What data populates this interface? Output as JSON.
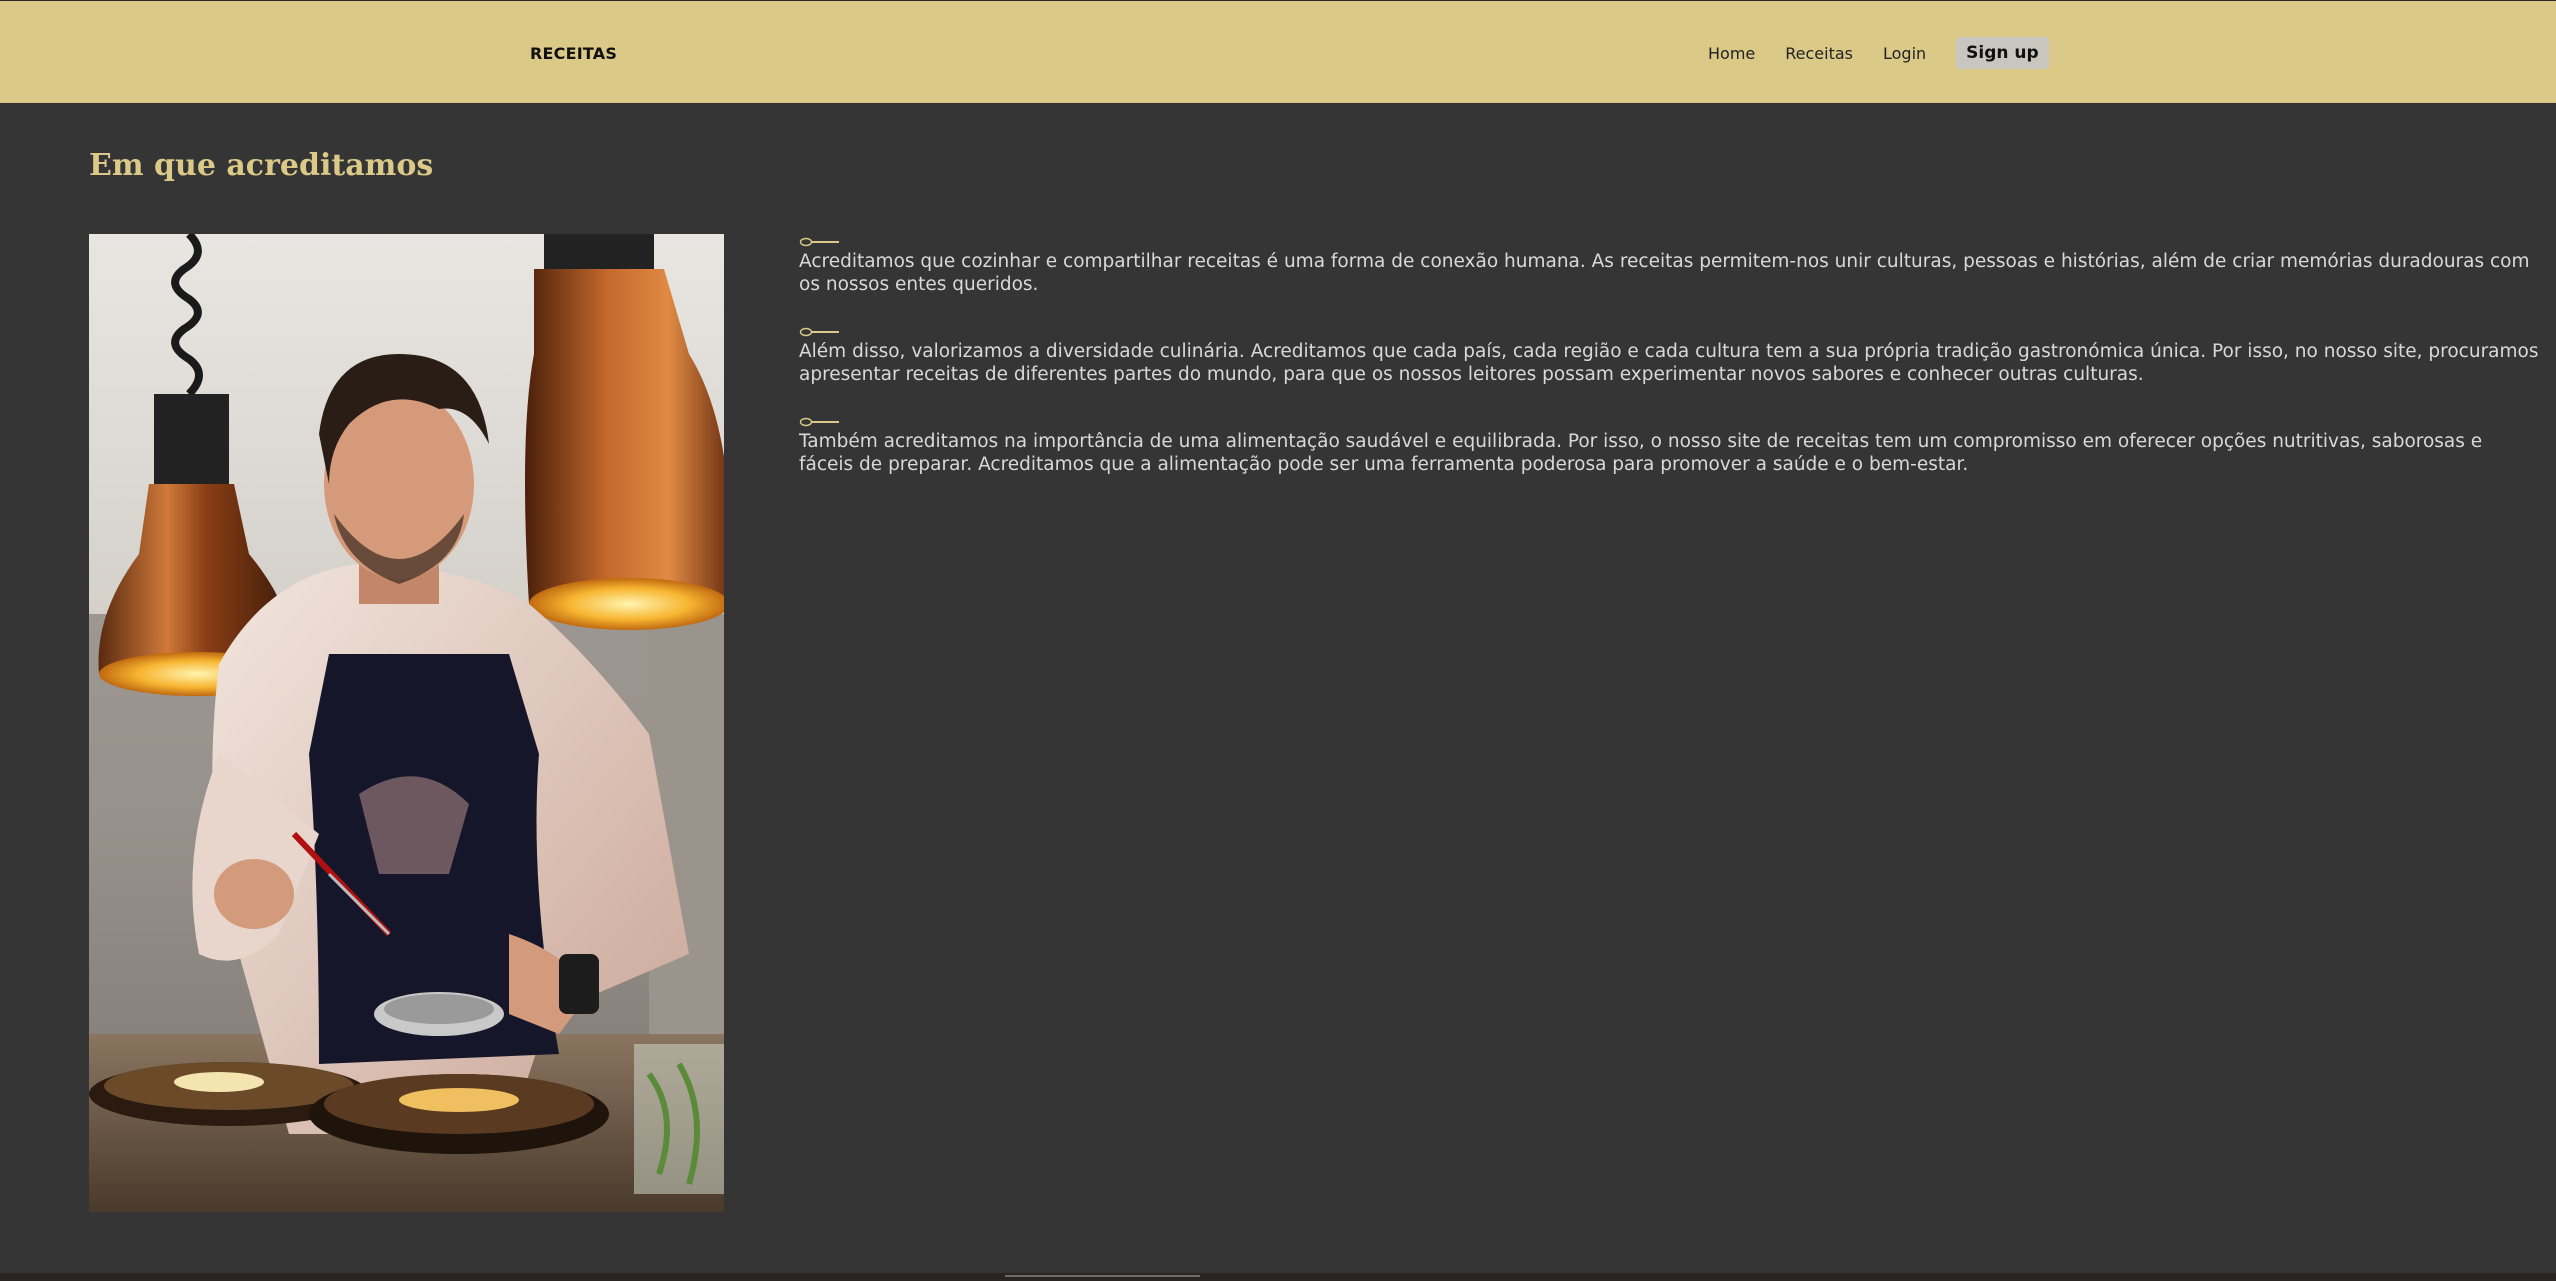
{
  "navbar": {
    "brand": "RECEITAS",
    "links": [
      "Home",
      "Receitas",
      "Login"
    ],
    "signup_label": "Sign up"
  },
  "main": {
    "title": "Em que acreditamos",
    "beliefs": [
      "Acreditamos que cozinhar e compartilhar receitas é uma forma de conexão humana. As receitas permitem-nos unir culturas, pessoas e histórias, além de criar memórias duradouras com os nossos entes queridos.",
      "Além disso, valorizamos a diversidade culinária. Acreditamos que cada país, cada região e cada cultura tem a sua própria tradição gastronómica única. Por isso, no nosso site, procuramos apresentar receitas de diferentes partes do mundo, para que os nossos leitores possam experimentar novos sabores e conhecer outras culturas.",
      "Também acreditamos na importância de uma alimentação saudável e equilibrada. Por isso, o nosso site de receitas tem um compromisso em oferecer opções nutritivas, saborosas e fáceis de preparar. Acreditamos que a alimentação pode ser uma ferramenta poderosa para promover a saúde e o bem-estar."
    ],
    "bullet_icon": "spoon-icon"
  },
  "colors": {
    "navbar_bg": "#dbc988",
    "page_bg": "#353535",
    "accent": "#dbc988",
    "text": "#d9d9d9",
    "button_bg": "#c9c6c0"
  }
}
